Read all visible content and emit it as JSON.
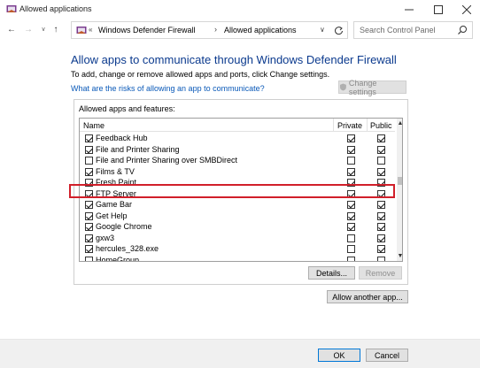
{
  "window": {
    "title": "Allowed applications"
  },
  "nav": {
    "back": "←",
    "forward": "→",
    "dropdown": "∨",
    "up": "↑",
    "breadcrumb_chevron": "«",
    "breadcrumbs": [
      "Windows Defender Firewall",
      "Allowed applications"
    ],
    "separator": "›",
    "search_placeholder": "Search Control Panel"
  },
  "content": {
    "heading": "Allow apps to communicate through Windows Defender Firewall",
    "description": "To add, change or remove allowed apps and ports, click Change settings.",
    "risk_link": "What are the risks of allowing an app to communicate?",
    "change_settings": "Change settings"
  },
  "apps": {
    "group_title": "Allowed apps and features:",
    "columns": {
      "name": "Name",
      "private": "Private",
      "public": "Public"
    },
    "rows": [
      {
        "name": "Feedback Hub",
        "enabled": true,
        "private": true,
        "public": true
      },
      {
        "name": "File and Printer Sharing",
        "enabled": true,
        "private": true,
        "public": true
      },
      {
        "name": "File and Printer Sharing over SMBDirect",
        "enabled": false,
        "private": false,
        "public": false
      },
      {
        "name": "Films & TV",
        "enabled": true,
        "private": true,
        "public": true
      },
      {
        "name": "Fresh Paint",
        "enabled": true,
        "private": true,
        "public": true
      },
      {
        "name": "FTP Server",
        "enabled": true,
        "private": true,
        "public": true,
        "highlighted": true
      },
      {
        "name": "Game Bar",
        "enabled": true,
        "private": true,
        "public": true
      },
      {
        "name": "Get Help",
        "enabled": true,
        "private": true,
        "public": true
      },
      {
        "name": "Google Chrome",
        "enabled": true,
        "private": true,
        "public": true
      },
      {
        "name": "gxw3",
        "enabled": true,
        "private": false,
        "public": true
      },
      {
        "name": "hercules_328.exe",
        "enabled": true,
        "private": false,
        "public": true
      },
      {
        "name": "HomeGroup",
        "enabled": false,
        "private": false,
        "public": false
      }
    ],
    "details_button": "Details...",
    "remove_button": "Remove",
    "allow_another_button": "Allow another app..."
  },
  "footer": {
    "ok": "OK",
    "cancel": "Cancel"
  },
  "colors": {
    "heading": "#0b3a8e",
    "link": "#0a59b8",
    "highlight": "#d11f2a"
  }
}
